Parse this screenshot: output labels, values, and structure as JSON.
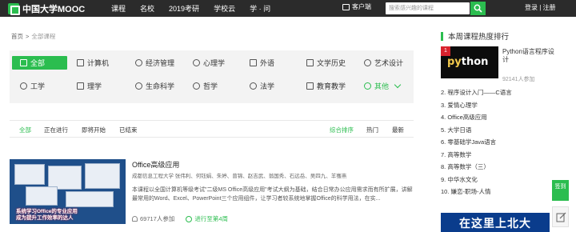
{
  "header": {
    "logo_text": "中国大学MOOC",
    "nav": [
      "课程",
      "名校",
      "2019考研",
      "学校云",
      "学 · 问"
    ],
    "client_label": "客户端",
    "search_placeholder": "搜索感兴趣的课程",
    "auth_text": "登录 | 注册"
  },
  "breadcrumb": {
    "home": "首页",
    "separator": ">",
    "current": "全部课程"
  },
  "categories": {
    "row1": [
      "全部",
      "计算机",
      "经济管理",
      "心理学",
      "外语",
      "文学历史",
      "艺术设计"
    ],
    "row2": [
      "工学",
      "理学",
      "生命科学",
      "哲学",
      "法学",
      "教育教学",
      "其他"
    ],
    "active": "全部"
  },
  "filters": {
    "status": [
      "全部",
      "正在进行",
      "即将开始",
      "已结束"
    ],
    "sort": [
      "综合排序",
      "热门",
      "最新"
    ]
  },
  "course": {
    "title": "Office高级应用",
    "meta": "成都信息工程大学    张伟利、何钰娟、朱婷、曾锦、赵吉武、翁国秀、石远岳、吴四九、羊骞燕",
    "desc": "本课程以全国计算机等级考试\"二级MS Office高级应用\"考试大纲为基础，结合日常办公应用需求而有所扩展，讲解最常用的Word、Excel、PowerPoint三个应用组件，让学习者较系统地掌握Office的科学用法，在实...",
    "learners": "69717人参加",
    "status": "进行至第4周",
    "thumb_caption_1": "系统学习Office的专业应用",
    "thumb_caption_2": "成为提升工作效率的达人"
  },
  "ranking": {
    "title": "本周课程热度排行",
    "first": {
      "rank": "1",
      "title": "Python语言程序设计",
      "count": "92141人参加",
      "thumb_text_1": "py",
      "thumb_text_2": "thon"
    },
    "items": [
      "2. 程序设计入门——C语言",
      "3. 爱情心理学",
      "4. Office高级应用",
      "5. 大学日语",
      "6. 零基础学Java语言",
      "7. 高等数学",
      "8. 高等数学（三）",
      "9. 中华水文化",
      "10. 嫌恋-职场-人情"
    ],
    "banner_text": "在这里上北大"
  },
  "side_buttons": {
    "sign_in": "签到"
  },
  "colors": {
    "accent": "#2bbd4f",
    "topbar": "#2b2b2b",
    "panel": "#f3f3f3"
  }
}
